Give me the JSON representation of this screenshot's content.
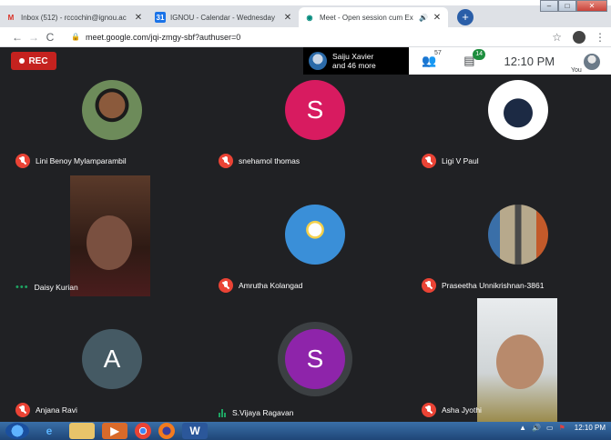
{
  "browser": {
    "tabs": [
      {
        "title": "Inbox (512) - rccochin@ignou.ac",
        "icon": "gmail-icon",
        "active": false
      },
      {
        "title": "IGNOU - Calendar - Wednesday",
        "icon": "calendar-icon",
        "active": false
      },
      {
        "title": "Meet - Open session cum Ex",
        "icon": "meet-icon",
        "active": true
      }
    ],
    "new_tab": "+",
    "url": "meet.google.com/jqi-zmgy-sbf?authuser=0"
  },
  "meet": {
    "rec_label": "REC",
    "presenter_name": "Saiju Xavier",
    "presenter_more": "and 46 more",
    "people_count": "57",
    "chat_badge": "14",
    "time": "12:10 PM",
    "you_label": "You",
    "colors": {
      "rec": "#c5221f",
      "muted": "#ea4335",
      "speaking": "#1ea362",
      "background": "#202124"
    },
    "participants": [
      {
        "name": "Lini Benoy Mylamparambil",
        "status": "muted",
        "avatar": "photo"
      },
      {
        "name": "snehamol thomas",
        "status": "muted",
        "avatar": "letter",
        "letter": "S",
        "color": "#d81b60"
      },
      {
        "name": "Ligi V Paul",
        "status": "muted",
        "avatar": "logo"
      },
      {
        "name": "Daisy Kurian",
        "status": "speaking-dots",
        "avatar": "video"
      },
      {
        "name": "Amrutha Kolangad",
        "status": "muted",
        "avatar": "photo"
      },
      {
        "name": "Praseetha Unnikrishnan-3861",
        "status": "muted",
        "avatar": "photo"
      },
      {
        "name": "Anjana Ravi",
        "status": "muted",
        "avatar": "letter",
        "letter": "A",
        "color": "#455a64"
      },
      {
        "name": "S.Vijaya Ragavan",
        "status": "speaking-bars",
        "avatar": "letter",
        "letter": "S",
        "color": "#8e24aa"
      },
      {
        "name": "Asha Jyothi",
        "status": "muted",
        "avatar": "video"
      }
    ]
  },
  "taskbar": {
    "time": "12:10 PM"
  }
}
